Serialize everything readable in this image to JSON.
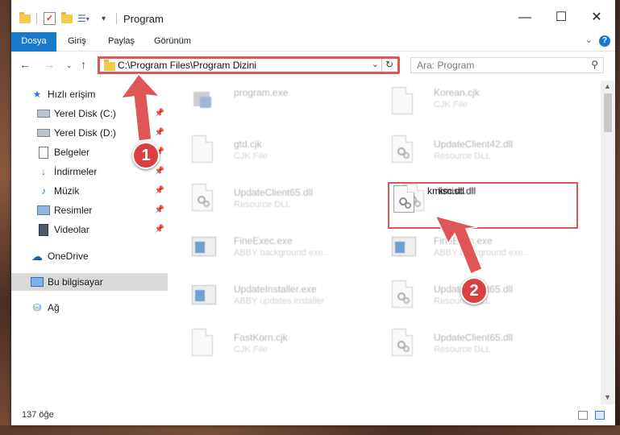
{
  "window": {
    "title": "Program"
  },
  "ribbon": {
    "tabs": [
      "Dosya",
      "Giriş",
      "Paylaş",
      "Görünüm"
    ],
    "help": "?"
  },
  "nav": {
    "address": "C:\\Program Files\\Program Dizini",
    "search_placeholder": "Ara: Program"
  },
  "sidebar": {
    "items": [
      {
        "label": "Hızlı erişim",
        "icon": "star-icon"
      },
      {
        "label": "Yerel Disk (C:)",
        "icon": "drive-icon"
      },
      {
        "label": "Yerel Disk (D:)",
        "icon": "drive-icon"
      },
      {
        "label": "Belgeler",
        "icon": "documents-icon"
      },
      {
        "label": "İndirmeler",
        "icon": "download-icon"
      },
      {
        "label": "Müzik",
        "icon": "music-icon"
      },
      {
        "label": "Resimler",
        "icon": "pictures-icon"
      },
      {
        "label": "Videolar",
        "icon": "videos-icon"
      },
      {
        "label": "OneDrive",
        "icon": "cloud-icon"
      },
      {
        "label": "Bu bilgisayar",
        "icon": "computer-icon"
      },
      {
        "label": "Ağ",
        "icon": "network-icon"
      }
    ]
  },
  "files": [
    {
      "name": "program.exe",
      "type": ""
    },
    {
      "name": "Korean.cjk",
      "type": "CJK File"
    },
    {
      "name": "gtd.cjk",
      "type": "CJK File"
    },
    {
      "name": "UpdateClient42.dll",
      "type": "Resource DLL"
    },
    {
      "name": "UpdateClient65.dll",
      "type": "Resource DLL"
    },
    {
      "name": "kmisc.dll",
      "type": ""
    },
    {
      "name": "FineExec.exe",
      "type": "ABBY background exe..."
    },
    {
      "name": "FineExec.exe",
      "type": "ABBY background exe..."
    },
    {
      "name": "UpdateInstaller.exe",
      "type": "ABBY updates installer"
    },
    {
      "name": "UpdateClient65.dll",
      "type": "Resource DLL"
    },
    {
      "name": "FastKorn.cjk",
      "type": "CJK File"
    },
    {
      "name": "UpdateClient65.dll",
      "type": "Resource DLL"
    }
  ],
  "status": {
    "count": "137 öğe"
  },
  "annotations": {
    "step1": "1",
    "step2": "2"
  },
  "colors": {
    "accent": "#1979ca",
    "highlight": "#e05656",
    "badge": "#d94040"
  }
}
